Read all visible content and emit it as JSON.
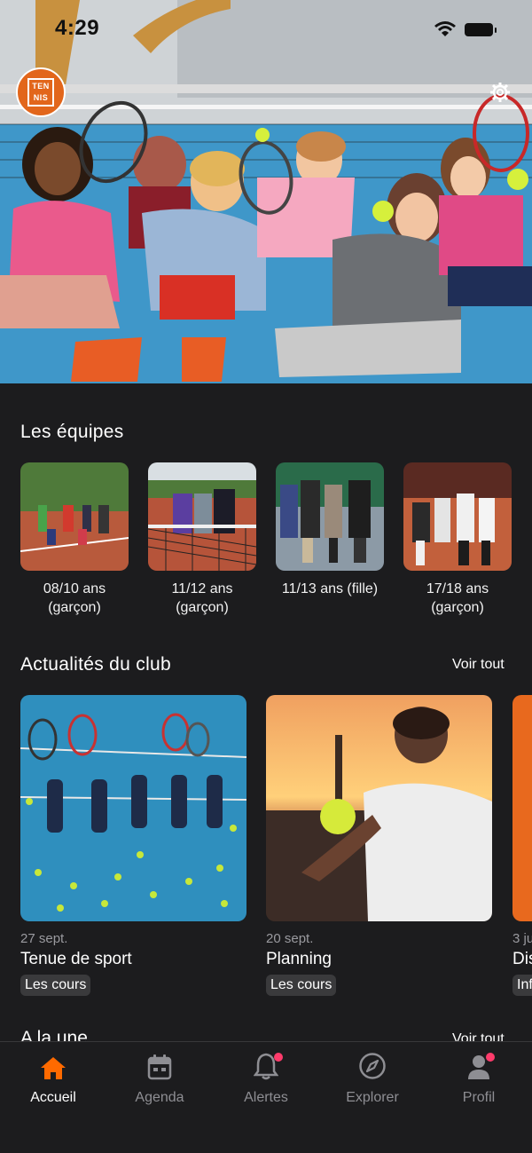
{
  "status": {
    "time": "4:29"
  },
  "header": {
    "logo_text": "TEN NIS"
  },
  "teams_section": {
    "title": "Les équipes",
    "teams": [
      {
        "label": "08/10 ans (garçon)"
      },
      {
        "label": "11/12 ans (garçon)"
      },
      {
        "label": "11/13 ans (fille)"
      },
      {
        "label": "17/18 ans (garçon)"
      }
    ]
  },
  "news_section": {
    "title": "Actualités du club",
    "see_all": "Voir tout",
    "items": [
      {
        "date": "27 sept.",
        "title": "Tenue de sport",
        "tag": "Les cours"
      },
      {
        "date": "20 sept.",
        "title": "Planning",
        "tag": "Les cours"
      },
      {
        "date": "3 ju",
        "title": "Dis",
        "tag": "Inf"
      }
    ]
  },
  "featured_section": {
    "title": "A la une",
    "see_all": "Voir tout"
  },
  "tabbar": {
    "tabs": [
      {
        "label": "Accueil",
        "icon": "home-icon"
      },
      {
        "label": "Agenda",
        "icon": "calendar-icon"
      },
      {
        "label": "Alertes",
        "icon": "bell-icon"
      },
      {
        "label": "Explorer",
        "icon": "compass-icon"
      },
      {
        "label": "Profil",
        "icon": "person-icon"
      }
    ],
    "accent": "#ff6a00",
    "badge_color": "#ff3b6b"
  }
}
